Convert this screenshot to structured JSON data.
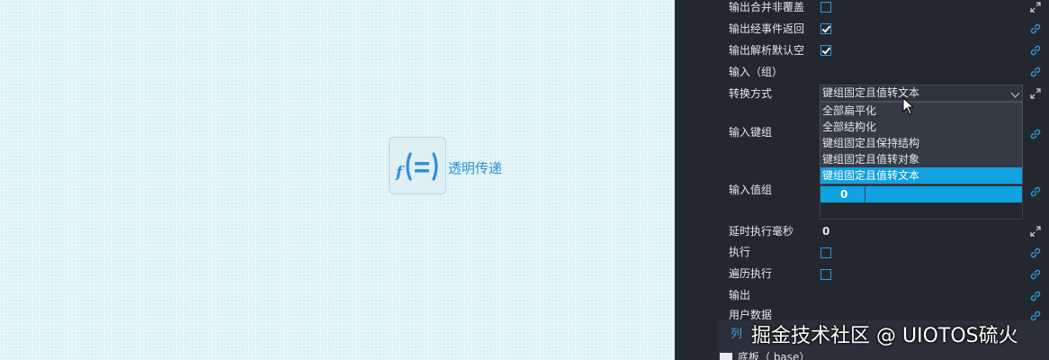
{
  "canvas": {
    "node": {
      "label": "透明传递",
      "icon": "function-equals-icon"
    }
  },
  "panel": {
    "rows": [
      {
        "label": "输出合并非覆盖",
        "type": "checkbox",
        "checked": false,
        "link": "expand-icon"
      },
      {
        "label": "输出经事件返回",
        "type": "checkbox",
        "checked": true,
        "link": "link-icon"
      },
      {
        "label": "输出解析默认空",
        "type": "checkbox",
        "checked": true,
        "link": "link-icon"
      },
      {
        "label": "输入（组）",
        "type": "none",
        "link": "link-icon"
      },
      {
        "label": "转换方式",
        "type": "select",
        "link": "expand-icon"
      },
      {
        "label": "输入键组",
        "type": "none",
        "link": "link-icon"
      },
      {
        "label": "输入值组",
        "type": "none",
        "link": "link-icon"
      },
      {
        "label": "延时执行毫秒",
        "type": "value",
        "value": "0",
        "link": "expand-icon"
      },
      {
        "label": "执行",
        "type": "checkbox",
        "checked": false,
        "link": "link-icon"
      },
      {
        "label": "遍历执行",
        "type": "checkbox",
        "checked": false,
        "link": "link-icon"
      },
      {
        "label": "输出",
        "type": "none",
        "link": "link-icon"
      },
      {
        "label": "用户数据",
        "type": "none",
        "link": "link-icon"
      }
    ],
    "conversion": {
      "selected": "键组固定且值转文本",
      "options": [
        "全部扁平化",
        "全部结构化",
        "键组固定且保持结构",
        "键组固定且值转对象",
        "键组固定且值转文本"
      ],
      "selected_index": 4
    },
    "value_group": {
      "cell": "0"
    },
    "bottom": {
      "tab": "列",
      "layer": "底板（ base）"
    }
  },
  "watermark": "掘金技术社区 @ UIOTOS硫火",
  "colors": {
    "accent": "#0fa1e0",
    "panel_bg": "#23272e",
    "canvas_bg": "#e6f6f6",
    "node_text": "#2c8fe0"
  }
}
